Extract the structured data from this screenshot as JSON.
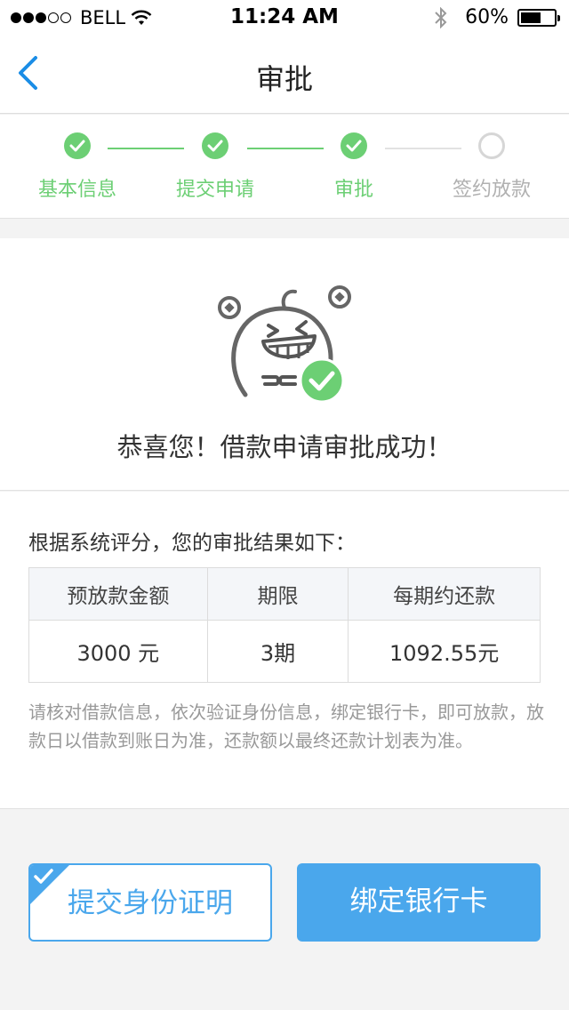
{
  "status_bar": {
    "carrier": "BELL",
    "time": "11:24 AM",
    "battery": "60%",
    "signal_dots_filled": 3,
    "signal_dots_total": 5,
    "battery_level": 0.6
  },
  "nav": {
    "title": "审批",
    "back_icon": "chevron-left-icon"
  },
  "steps": [
    {
      "label": "基本信息",
      "state": "done"
    },
    {
      "label": "提交申请",
      "state": "done"
    },
    {
      "label": "审批",
      "state": "done"
    },
    {
      "label": "签约放款",
      "state": "todo"
    }
  ],
  "success": {
    "message": "恭喜您！借款申请审批成功！",
    "illustration": "happy-mascot-with-check"
  },
  "result": {
    "intro": "根据系统评分，您的审批结果如下：",
    "table": {
      "headers": [
        "预放款金额",
        "期限",
        "每期约还款"
      ],
      "row": [
        "3000 元",
        "3期",
        "1092.55元"
      ]
    },
    "note": "请核对借款信息，依次验证身份信息，绑定银行卡，即可放款，放款日以借款到账日为准，还款额以最终还款计划表为准。"
  },
  "actions": {
    "submit_id": "提交身份证明",
    "bind_card": "绑定银行卡"
  },
  "colors": {
    "green": "#6ccf74",
    "blue": "#4aa7ec",
    "grey": "#b0b0b0"
  }
}
